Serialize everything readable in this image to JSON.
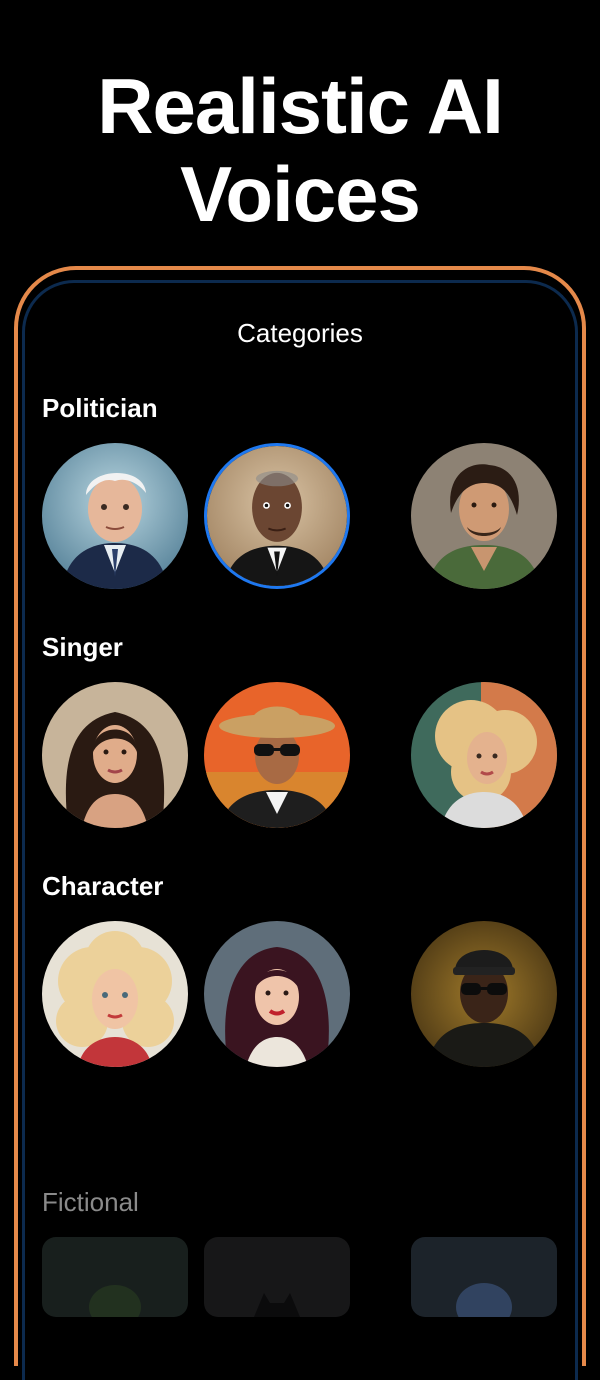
{
  "hero": {
    "line1": "Realistic AI",
    "line2": "Voices"
  },
  "screen": {
    "title": "Categories"
  },
  "colors": {
    "frame_orange": "#e5894a",
    "selected_ring": "#1e78f0",
    "background": "#000000"
  },
  "categories": [
    {
      "label": "Politician",
      "voices": [
        {
          "icon": "elderly-politician-portrait",
          "selected": false
        },
        {
          "icon": "elderly-man-suit-portrait",
          "selected": true
        },
        {
          "icon": "young-man-curly-hair-portrait",
          "selected": false
        }
      ]
    },
    {
      "label": "Singer",
      "voices": [
        {
          "icon": "woman-dark-hair-portrait",
          "selected": false
        },
        {
          "icon": "man-hat-sunglasses-portrait",
          "selected": false
        },
        {
          "icon": "woman-blonde-curls-portrait",
          "selected": false
        }
      ]
    },
    {
      "label": "Character",
      "voices": [
        {
          "icon": "woman-blonde-portrait",
          "selected": false
        },
        {
          "icon": "woman-red-lips-portrait",
          "selected": false
        },
        {
          "icon": "man-cap-sunglasses-portrait",
          "selected": false
        }
      ]
    },
    {
      "label": "Fictional",
      "voices": [
        {
          "icon": "green-hero-tile"
        },
        {
          "icon": "bat-hero-tile"
        },
        {
          "icon": "blue-creature-tile"
        }
      ]
    }
  ]
}
